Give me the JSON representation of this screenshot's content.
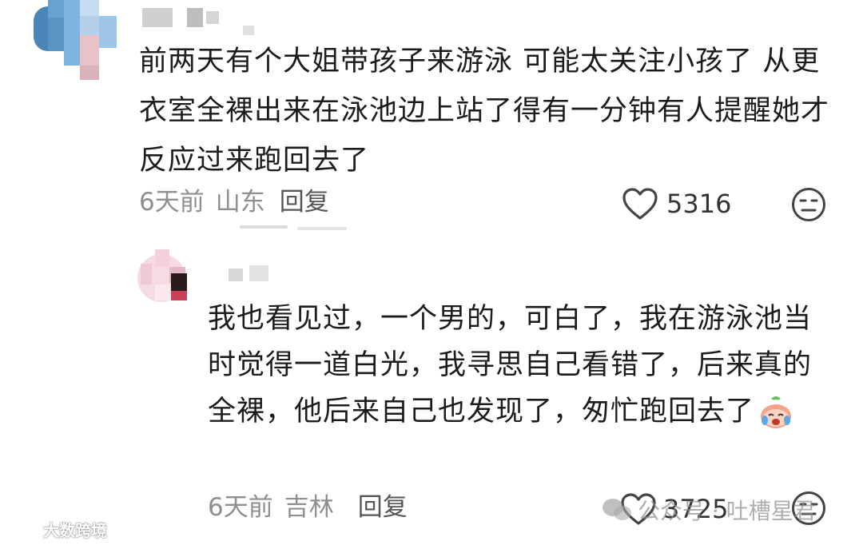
{
  "comment1": {
    "text": "前两天有个大姐带孩子来游泳 可能太关注小孩了 从更衣室全裸出来在泳池边上站了得有一分钟有人提醒她才反应过来跑回去了",
    "time": "6天前",
    "location": "山东",
    "reply_label": "回复",
    "like_count": "5316"
  },
  "comment2": {
    "text": "我也看见过，一个男的，可白了，我在游泳池当时觉得一道白光，我寻思自己看错了，后来真的全裸，他后来自己也发现了，匆忙跑回去了",
    "time": "6天前",
    "location": "吉林",
    "reply_label": "回复",
    "like_count": "3725"
  },
  "watermarks": {
    "left": "大数跨境",
    "right": "公众号 · 吐槽星君"
  },
  "icons": {
    "like": "heart-outline-icon",
    "dislike": "unamused-face-icon",
    "emoji": "crying-laughing-sticker-icon"
  },
  "colors": {
    "text": "#1c1c1c",
    "meta": "#8f8f8f",
    "reply": "#555555"
  }
}
